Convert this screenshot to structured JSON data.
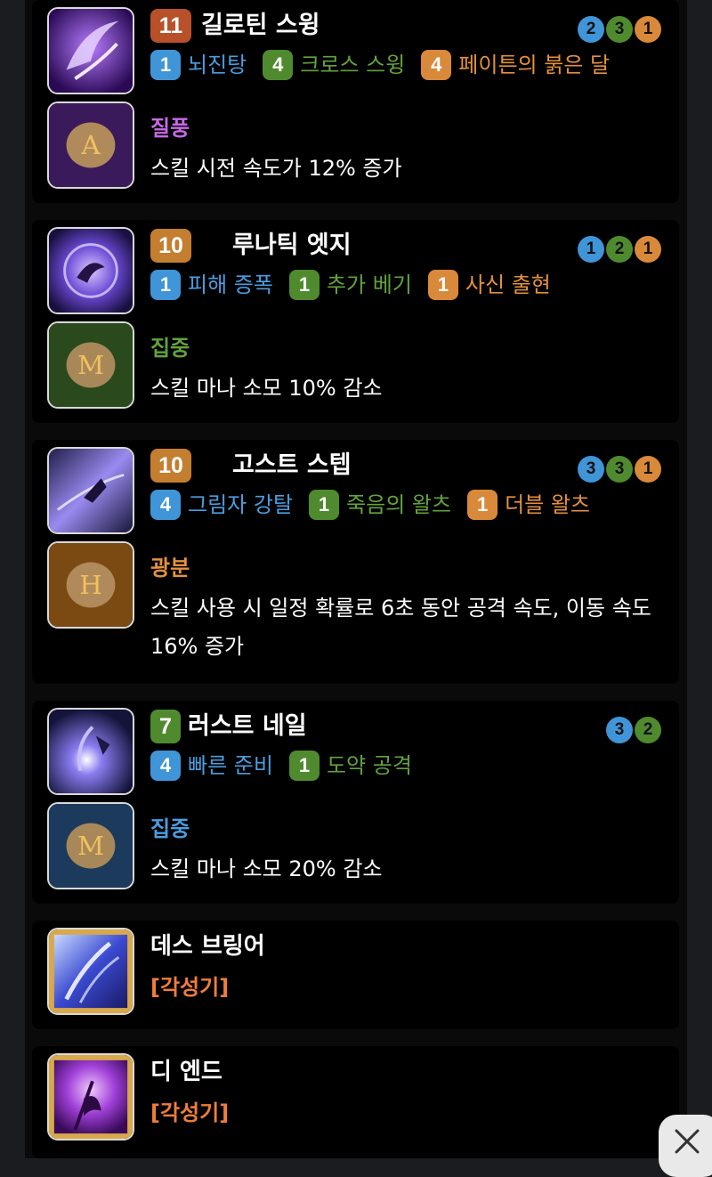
{
  "skills": [
    {
      "level": "11",
      "name": "길로틴 스윙",
      "dots": [
        "2",
        "3",
        "1"
      ],
      "tripods": [
        {
          "num": "1",
          "label": "뇌진탕",
          "color": "blue"
        },
        {
          "num": "4",
          "label": "크로스 스윙",
          "color": "green"
        },
        {
          "num": "4",
          "label": "페이튼의 붉은 달",
          "color": "orange"
        }
      ],
      "rune_name": "질풍",
      "rune_desc": "스킬 시전 속도가 12% 증가"
    },
    {
      "level": "10",
      "name": "루나틱 엣지",
      "dots": [
        "1",
        "2",
        "1"
      ],
      "tripods": [
        {
          "num": "1",
          "label": "피해 증폭",
          "color": "blue"
        },
        {
          "num": "1",
          "label": "추가 베기",
          "color": "green"
        },
        {
          "num": "1",
          "label": "사신 출현",
          "color": "orange"
        }
      ],
      "rune_name": "집중",
      "rune_desc": "스킬 마나 소모 10% 감소"
    },
    {
      "level": "10",
      "name": "고스트 스텝",
      "dots": [
        "3",
        "3",
        "1"
      ],
      "tripods": [
        {
          "num": "4",
          "label": "그림자 강탈",
          "color": "blue"
        },
        {
          "num": "1",
          "label": "죽음의 왈츠",
          "color": "green"
        },
        {
          "num": "1",
          "label": "더블 왈츠",
          "color": "orange"
        }
      ],
      "rune_name": "광분",
      "rune_desc_line1": "스킬 사용 시 일정 확률로 6초 동안 공격 속도, 이동 속도",
      "rune_desc_line2": "16% 증가"
    },
    {
      "level": "7",
      "name": "러스트 네일",
      "dots": [
        "3",
        "2"
      ],
      "tripods": [
        {
          "num": "4",
          "label": "빠른 준비",
          "color": "blue"
        },
        {
          "num": "1",
          "label": "도약 공격",
          "color": "green"
        }
      ],
      "rune_name": "집중",
      "rune_desc": "스킬 마나 소모 20% 감소"
    }
  ],
  "awakenings": [
    {
      "name": "데스 브링어",
      "tag": "[각성기]"
    },
    {
      "name": "디 엔드",
      "tag": "[각성기]"
    }
  ],
  "colors": {
    "blue": "#3f95d8",
    "green": "#4f8a2f",
    "orange": "#d9893a",
    "rune_purple": "#c86ae6",
    "rune_green": "#62a33c",
    "rune_orange": "#e3913f",
    "rune_blue": "#4a9ee0",
    "awakening_tag": "#f07d3c"
  },
  "icons": {
    "close": "close-icon"
  }
}
